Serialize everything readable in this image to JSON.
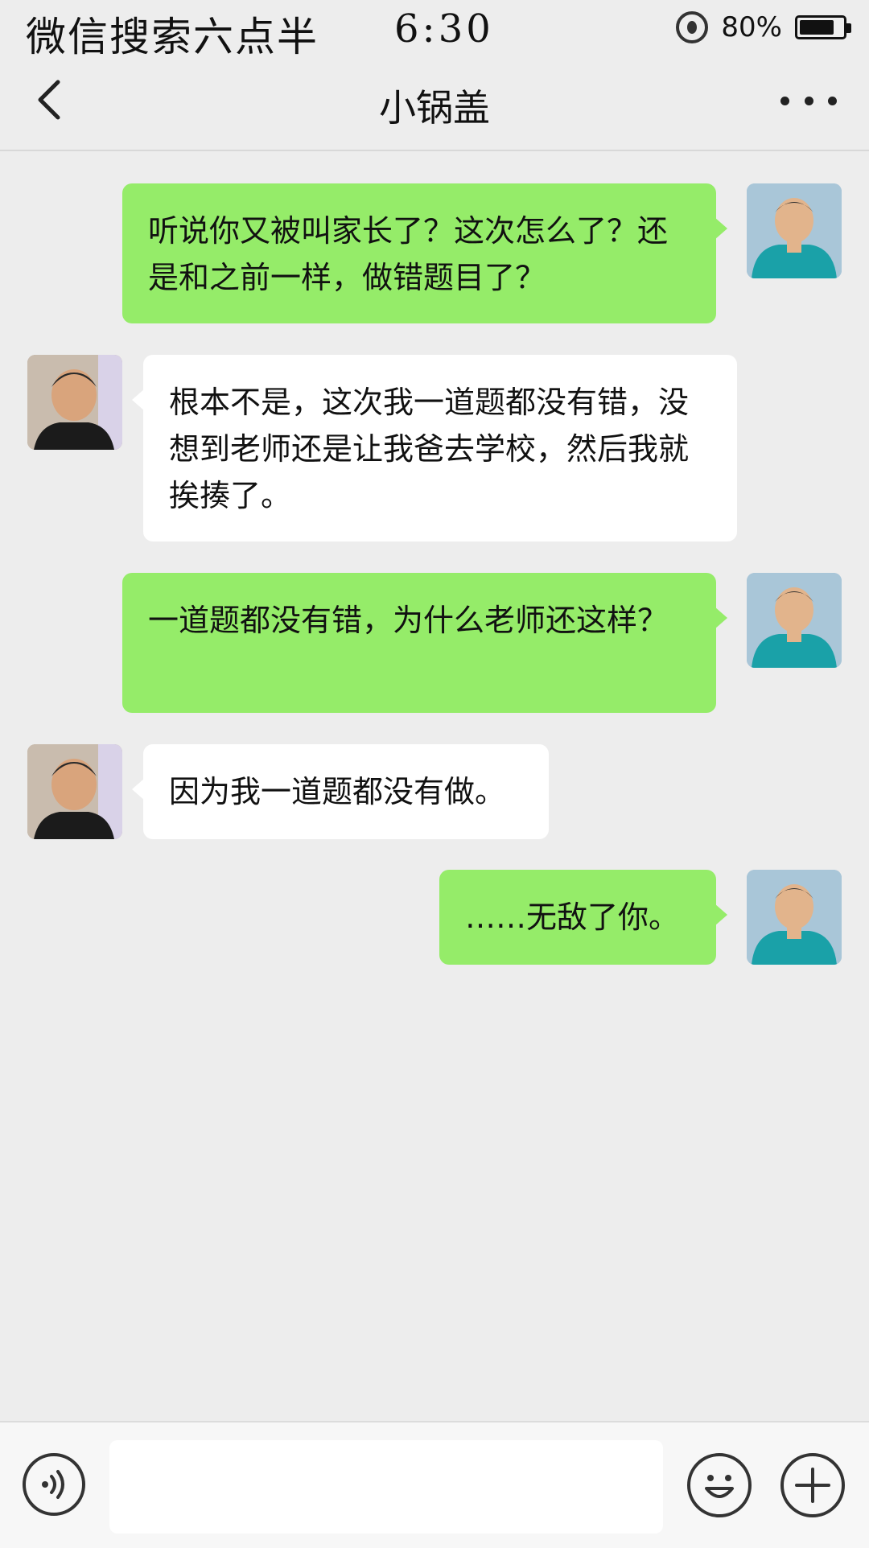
{
  "status_bar": {
    "carrier": "微信搜索六点半",
    "time": "6:30",
    "battery_percent": "80%",
    "battery_level": 0.8,
    "icons": [
      "alarm-icon",
      "battery-icon"
    ]
  },
  "header": {
    "title": "小锅盖",
    "back_icon": "chevron-left-icon",
    "more_icon": "more-dots-icon"
  },
  "messages": [
    {
      "sender": "self",
      "text": "听说你又被叫家长了？这次怎么了？还是和之前一样，做错题目了？"
    },
    {
      "sender": "other",
      "text": "根本不是，这次我一道题都没有错，没想到老师还是让我爸去学校，然后我就挨揍了。"
    },
    {
      "sender": "self",
      "text": "一道题都没有错，为什么老师还这样？"
    },
    {
      "sender": "other",
      "text": "因为我一道题都没有做。"
    },
    {
      "sender": "self",
      "text": "……无敌了你。"
    }
  ],
  "input_bar": {
    "text_value": "",
    "voice_icon": "voice-icon",
    "emoji_icon": "emoji-icon",
    "plus_icon": "plus-icon"
  },
  "colors": {
    "self_bubble": "#95ec69",
    "other_bubble": "#ffffff",
    "background": "#ededed"
  }
}
